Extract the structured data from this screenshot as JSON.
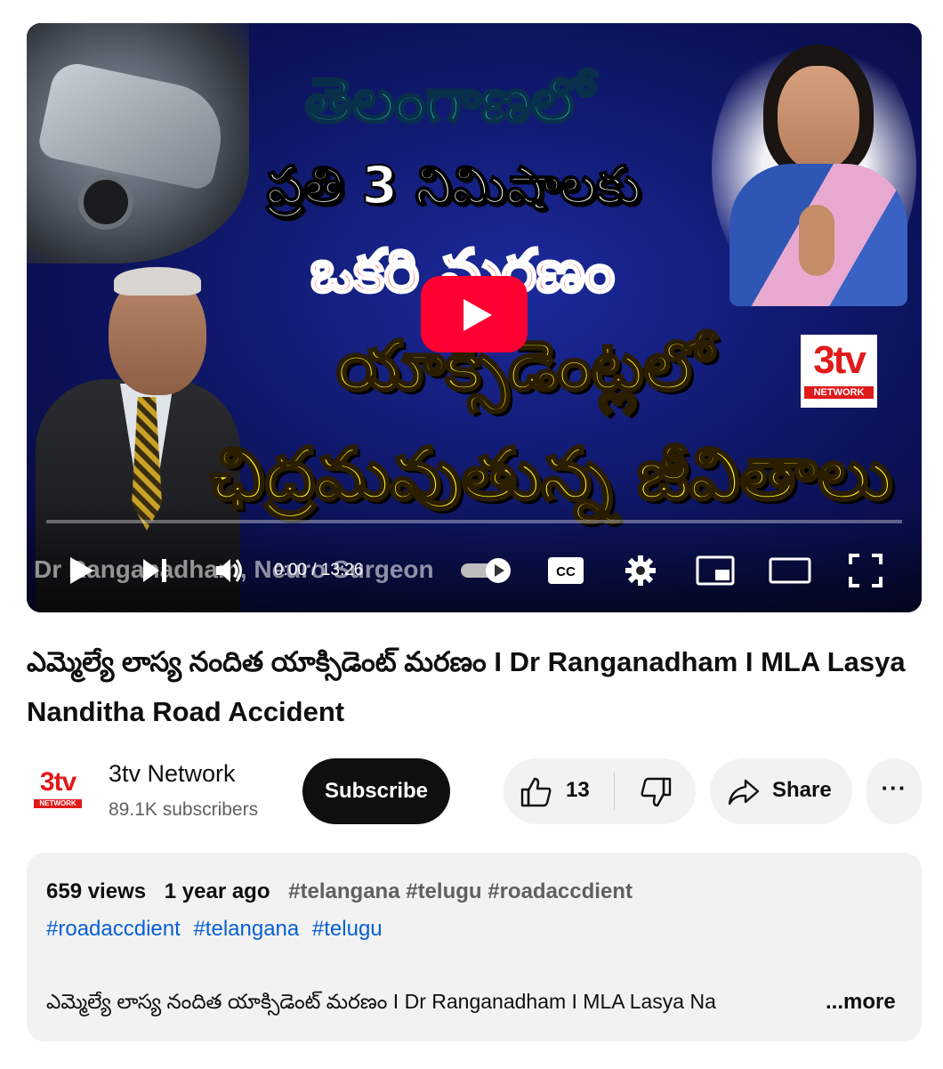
{
  "player": {
    "thumbnail_text": {
      "line1": "తెలంగాణలో",
      "line2": "ప్రతి 3 నిమిషాలకు",
      "line3": "ఒకరి మరణం",
      "line4": "యాక్సిడెంట్లలో",
      "line5": "ఛిద్రమవుతున్న జీవితాలు"
    },
    "thumbnail_logo": {
      "big": "3tv",
      "small": "NETWORK"
    },
    "overlay_name": "Dr Ranganadham, Neuro Surgeon",
    "time_current": "0:00",
    "time_separator": " / ",
    "time_total": "13:26",
    "progress_fraction": 0.0,
    "play_button_color": "#ff0033"
  },
  "video": {
    "title": "ఎమ్మెల్యే లాస్య నందిత యాక్సిడెంట్ మరణం I Dr Ranganadham I MLA Lasya Nanditha Road Accident"
  },
  "channel": {
    "avatar": {
      "big": "3tv",
      "small": "NETWORK"
    },
    "name": "3tv Network",
    "subscribers": "89.1K subscribers",
    "subscribe_label": "Subscribe"
  },
  "actions": {
    "like_count": "13",
    "share_label": "Share",
    "more_label": "···"
  },
  "description": {
    "views": "659 views",
    "age": "1 year ago",
    "top_hashtags": "#telangana #telugu #roadaccdient",
    "hashtags": [
      "#roadaccdient",
      "#telangana",
      "#telugu"
    ],
    "preview": "ఎమ్మెల్యే లాస్య నందిత యాక్సిడెంట్ మరణం I Dr Ranganadham I MLA Lasya Na",
    "more_label": "...more"
  },
  "colors": {
    "accent_red": "#ff0033",
    "link_blue": "#065fd4",
    "chip_bg": "#f2f2f2",
    "text_primary": "#0f0f0f",
    "text_secondary": "#606060"
  }
}
